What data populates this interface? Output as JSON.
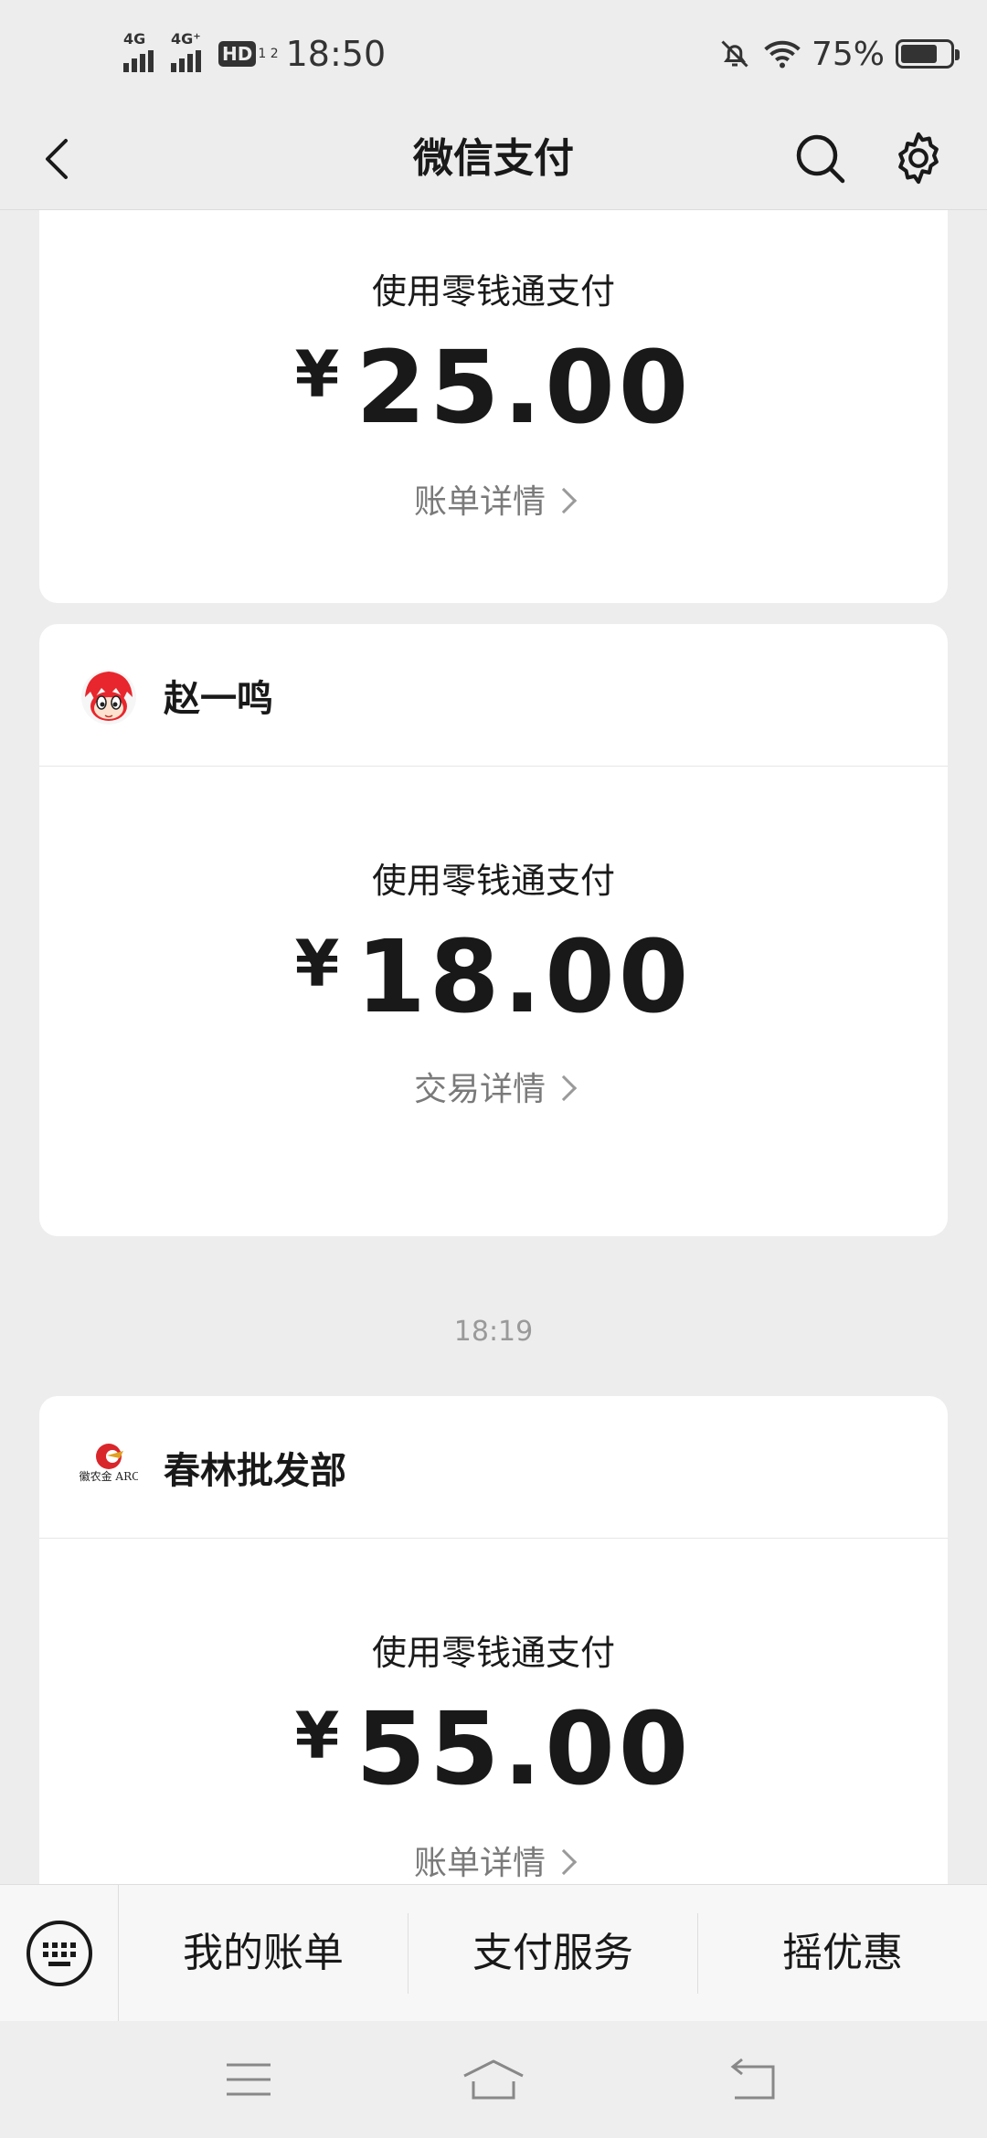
{
  "status_bar": {
    "net1": "4G",
    "net2": "4G⁺",
    "hd": "HD",
    "hd_sub": "1 2",
    "time": "18:50",
    "battery_pct": "75%",
    "battery_level": 0.75,
    "icons": [
      "signal-icon",
      "hd-icon",
      "mute-bell-icon",
      "wifi-icon",
      "battery-icon"
    ]
  },
  "nav": {
    "title": "微信支付",
    "icons": [
      "back-arrow-icon",
      "search-icon",
      "gear-icon"
    ]
  },
  "messages": [
    {
      "merchant": "",
      "pay_method": "使用零钱通支付",
      "currency": "¥",
      "amount": "25.00",
      "detail_label": "账单详情"
    },
    {
      "merchant": "赵一鸣",
      "avatar_icon": "cartoon-boy-avatar-icon",
      "pay_method": "使用零钱通支付",
      "currency": "¥",
      "amount": "18.00",
      "detail_label": "交易详情"
    },
    {
      "timestamp": "18:19",
      "merchant": "春林批发部",
      "avatar_icon": "bank-logo-icon",
      "pay_method": "使用零钱通支付",
      "currency": "¥",
      "amount": "55.00",
      "detail_label": "账单详情"
    }
  ],
  "bank_logo_text": "安徽农金 ARCU",
  "bottom_menu": {
    "keyboard_icon": "keyboard-icon",
    "items": [
      "我的账单",
      "支付服务",
      "摇优惠"
    ]
  },
  "system_nav": [
    "menu-icon",
    "home-icon",
    "back-icon"
  ],
  "colors": {
    "background": "#ededed",
    "card": "#ffffff",
    "text": "#191919",
    "muted": "#7a7a7a",
    "avatar_red": "#e8262d"
  }
}
